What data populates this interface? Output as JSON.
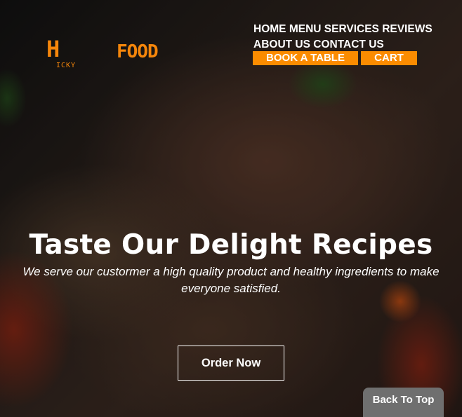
{
  "logo": {
    "big": "H",
    "main": "FOOD",
    "sub": "ICKY"
  },
  "nav": {
    "links": [
      "HOME",
      "MENU",
      "SERVICES",
      "REVIEWS",
      "ABOUT US",
      "CONTACT US"
    ],
    "book_label": "BOOK A TABLE",
    "cart_label": "CART"
  },
  "hero": {
    "title": "Taste Our Delight Recipes",
    "subtitle": "We serve our custormer a high quality product and healthy ingredients to make everyone satisfied.",
    "cta_label": "Order Now"
  },
  "back_to_top_label": "Back To Top",
  "colors": {
    "accent": "#fb8c00",
    "logo": "#f5860b",
    "back_to_top_bg": "#6f6f6f"
  }
}
